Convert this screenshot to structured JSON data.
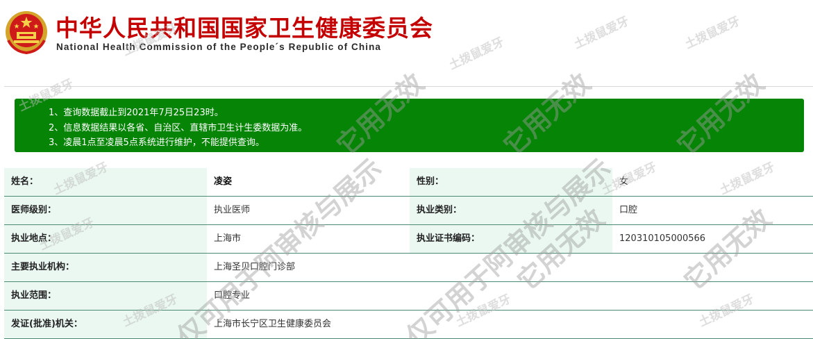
{
  "header": {
    "title_cn": "中华人民共和国国家卫生健康委员会",
    "title_en": "National Health Commission of the People´s Republic of China",
    "emblem_icon": "national-emblem-icon"
  },
  "notice": {
    "bg_color": "#058405",
    "items": [
      "1、查询数据截止到2021年7月25日23时。",
      "2、信息数据结果以各省、自治区、直辖市卫生计生委数据为准。",
      "3、凌晨1点至凌晨5点系统进行维护，不能提供查询。"
    ]
  },
  "info": {
    "name_label": "姓名：",
    "name_value": "凌姿",
    "gender_label": "性别：",
    "gender_value": "女",
    "level_label": "医师级别：",
    "level_value": "执业医师",
    "category_label": "执业类别：",
    "category_value": "口腔",
    "location_label": "执业地点：",
    "location_value": "上海市",
    "cert_label": "执业证书编码：",
    "cert_value": "120310105000566",
    "institution_label": "主要执业机构：",
    "institution_value": "上海圣贝口腔门诊部",
    "scope_label": "执业范围：",
    "scope_value": "口腔专业",
    "authority_label": "发证(批准)机关：",
    "authority_value": "上海市长宁区卫生健康委员会"
  },
  "watermark": {
    "small_text": "土拨鼠爱牙",
    "large_text_1": "仅可用于阿审核与展示",
    "large_text_2": "它用无效"
  }
}
